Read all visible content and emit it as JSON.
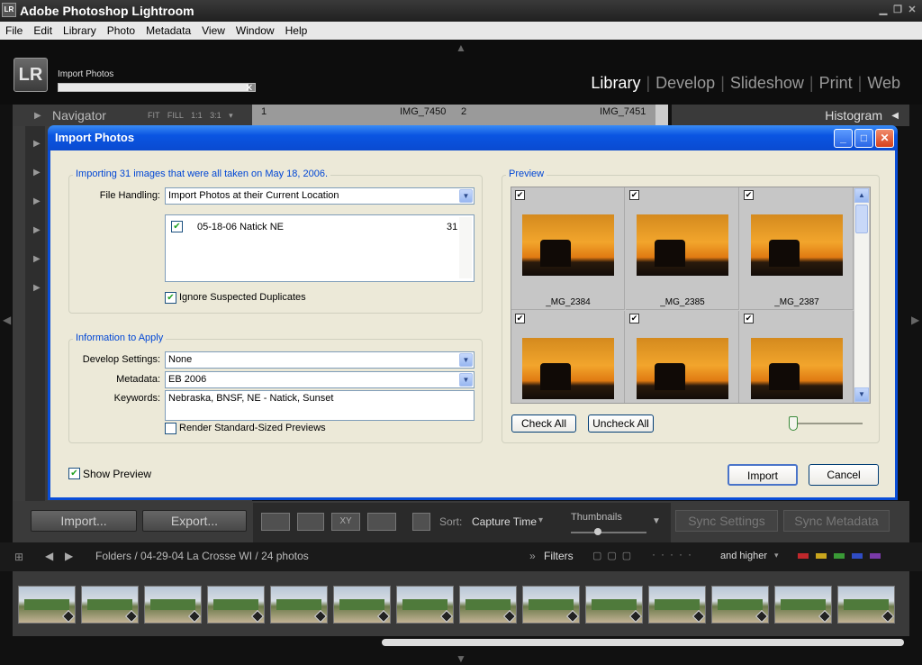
{
  "window": {
    "title": "Adobe Photoshop Lightroom",
    "icon_text": "LR"
  },
  "menu": [
    "File",
    "Edit",
    "Library",
    "Photo",
    "Metadata",
    "View",
    "Window",
    "Help"
  ],
  "topbar": {
    "logo": "LR",
    "progress_label": "Import Photos",
    "progress_fraction": 0.97,
    "modules": [
      "Library",
      "Develop",
      "Slideshow",
      "Print",
      "Web"
    ],
    "active_module": "Library"
  },
  "left_panel": {
    "navigator_label": "Navigator",
    "zoom_options": [
      "FIT",
      "FILL",
      "1:1",
      "3:1"
    ]
  },
  "grid_header": {
    "cell1_index": "1",
    "cell1_name": "IMG_7450",
    "cell2_index": "2",
    "cell2_name": "IMG_7451"
  },
  "right_panel": {
    "histogram_label": "Histogram"
  },
  "dialog": {
    "title": "Import Photos",
    "import_group_label": "Importing 31 images that were all taken on May 18, 2006.",
    "file_handling_label": "File Handling:",
    "file_handling_value": "Import Photos at their Current Location",
    "folder_name": "05-18-06 Natick NE",
    "folder_count": "31",
    "ignore_duplicates_label": "Ignore Suspected Duplicates",
    "info_group_label": "Information to Apply",
    "develop_label": "Develop Settings:",
    "develop_value": "None",
    "metadata_label": "Metadata:",
    "metadata_value": "EB 2006",
    "keywords_label": "Keywords:",
    "keywords_value": "Nebraska, BNSF, NE - Natick, Sunset",
    "render_previews_label": "Render Standard-Sized Previews",
    "show_preview_label": "Show Preview",
    "preview_label": "Preview",
    "previews": [
      "_MG_2384",
      "_MG_2385",
      "_MG_2387",
      "",
      "",
      ""
    ],
    "check_all": "Check All",
    "uncheck_all": "Uncheck All",
    "import_btn": "Import",
    "cancel_btn": "Cancel"
  },
  "toolbar": {
    "import_btn": "Import...",
    "export_btn": "Export...",
    "sort_label": "Sort:",
    "sort_value": "Capture Time",
    "thumbnails_label": "Thumbnails",
    "sync_settings": "Sync Settings",
    "sync_metadata": "Sync Metadata"
  },
  "filmbar": {
    "path": "Folders / 04-29-04 La Crosse WI / 24 photos",
    "filters_label": "Filters",
    "rating_label": "and higher",
    "color_labels": [
      "#c0282c",
      "#c9a51d",
      "#3a9a36",
      "#2f4cc4",
      "#7a3aa8"
    ]
  }
}
